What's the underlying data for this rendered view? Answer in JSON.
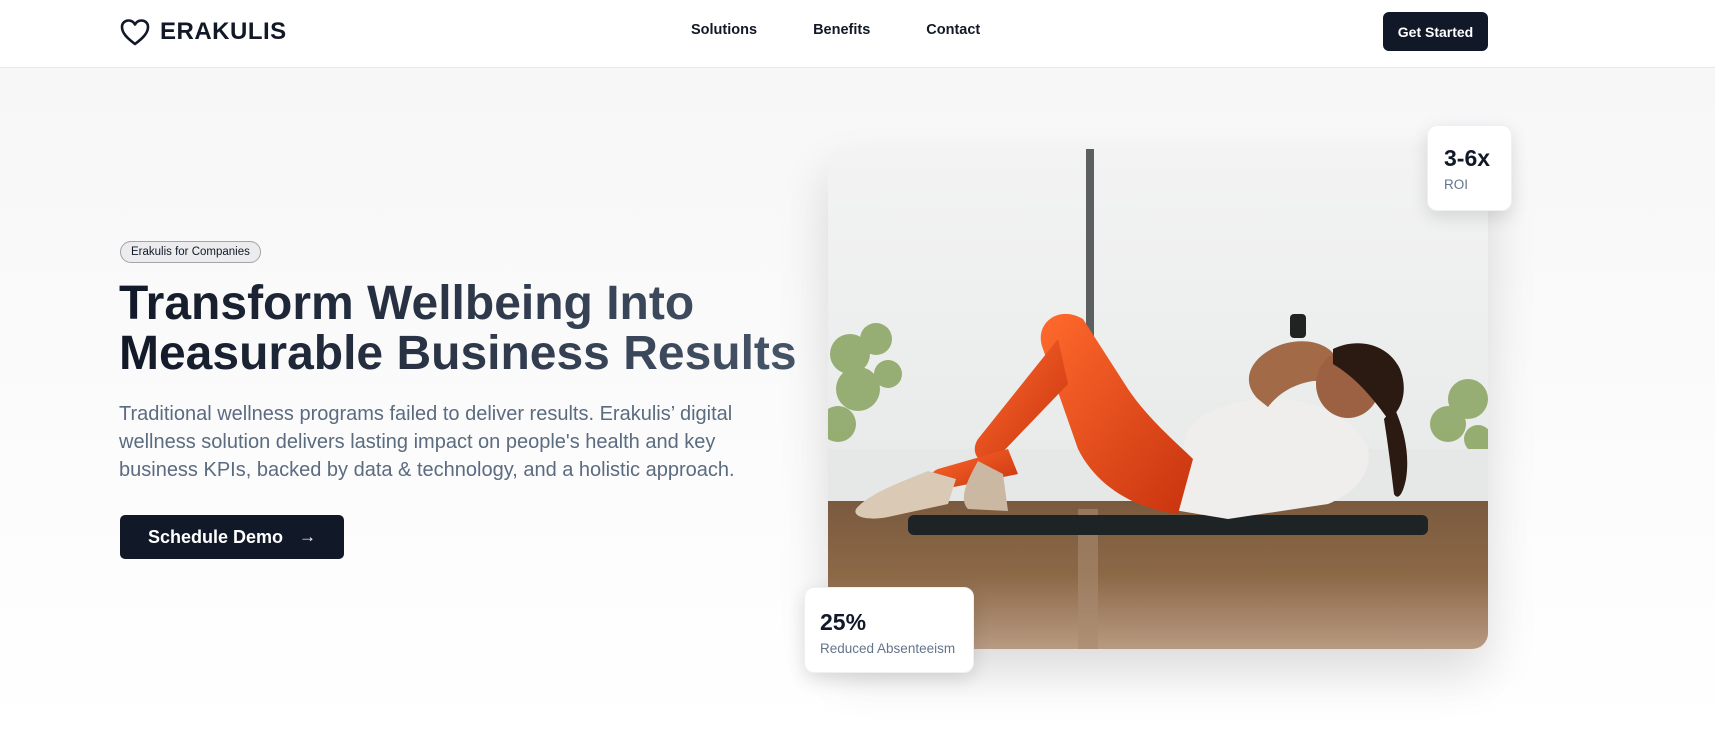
{
  "brand": {
    "name": "ERAKULIS",
    "icon": "heart-outline-icon"
  },
  "nav": {
    "links": [
      "Solutions",
      "Benefits",
      "Contact"
    ],
    "cta_label": "Get Started"
  },
  "hero": {
    "badge": "Erakulis for Companies",
    "headline_line1": "Transform Wellbeing Into",
    "headline_line2": "Measurable Business Results",
    "lead": "Traditional wellness programs failed to deliver results. Erakulis’ digital wellness solution delivers lasting impact on people's health and key business KPIs, backed by data & technology, and a holistic approach.",
    "cta_label": "Schedule Demo",
    "cta_icon": "arrow-right-icon"
  },
  "stats": [
    {
      "value": "3-6x",
      "label": "ROI"
    },
    {
      "value": "25%",
      "label": "Reduced Absenteeism"
    }
  ],
  "image": {
    "subject": "woman-doing-crunches-photo"
  },
  "colors": {
    "primary": "#111827",
    "muted_text": "#5b6b80",
    "background": "#f6f6f7"
  }
}
